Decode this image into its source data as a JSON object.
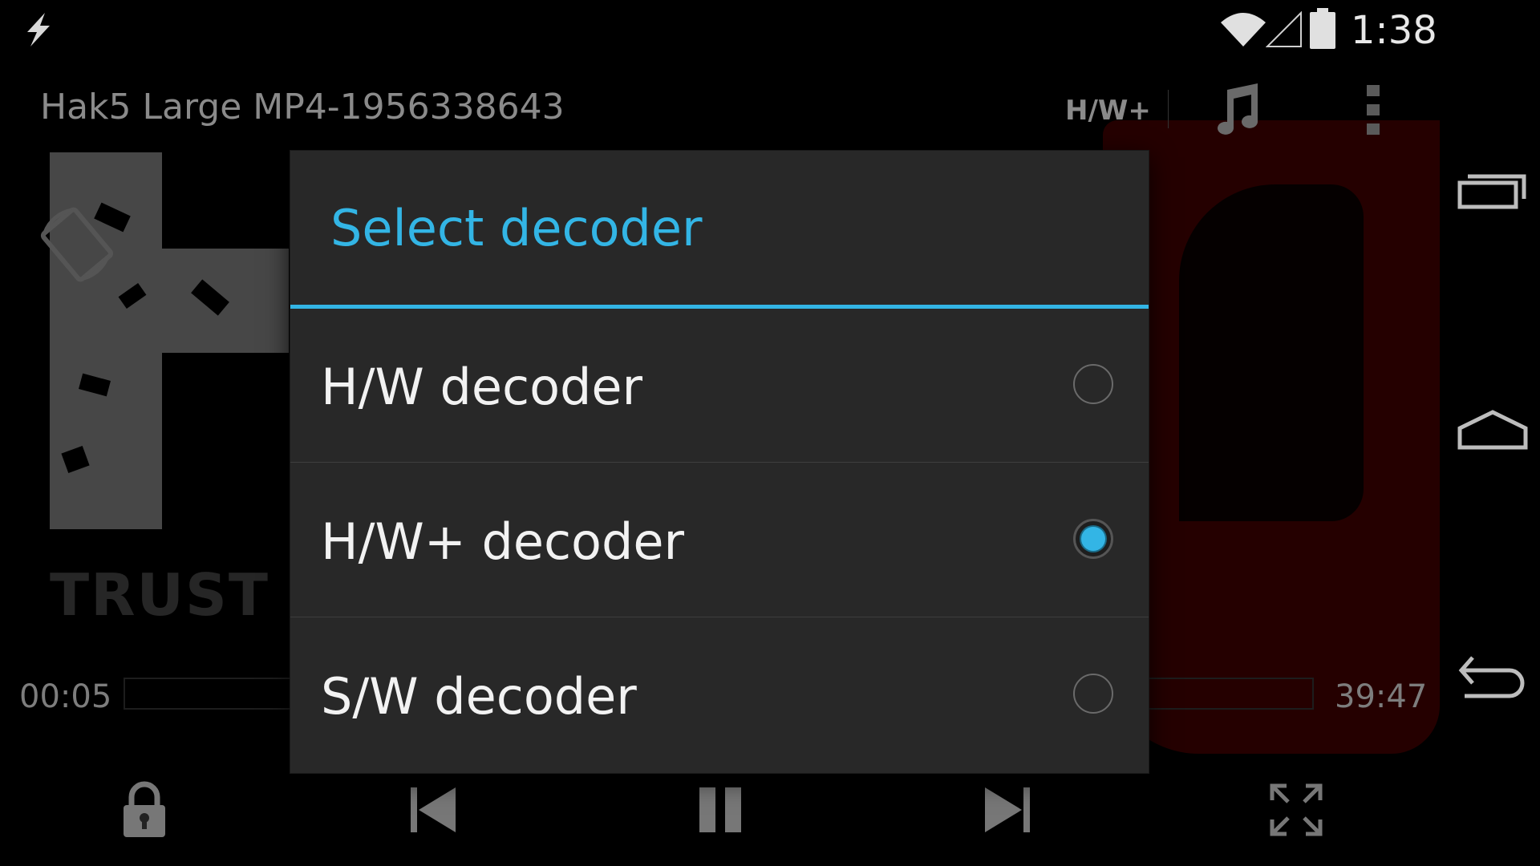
{
  "status_bar": {
    "time": "1:38",
    "icons": [
      "flash-icon",
      "wifi-icon",
      "signal-icon",
      "battery-icon"
    ]
  },
  "player": {
    "title": "Hak5 Large MP4-1956338643",
    "decoder_indicator": "H/W+",
    "background_text": "TRUST Y",
    "time_elapsed": "00:05",
    "time_total": "39:47",
    "controls": [
      "lock-icon",
      "previous-icon",
      "pause-icon",
      "next-icon",
      "fullscreen-icon"
    ]
  },
  "dialog": {
    "title": "Select decoder",
    "options": [
      {
        "label": "H/W decoder",
        "selected": false
      },
      {
        "label": "H/W+ decoder",
        "selected": true
      },
      {
        "label": "S/W decoder",
        "selected": false
      }
    ]
  },
  "nav_bar": {
    "buttons": [
      "recents-icon",
      "home-icon",
      "back-icon"
    ]
  },
  "colors": {
    "accent": "#33b5e5",
    "dialog_bg": "#282828",
    "background": "#000000"
  }
}
